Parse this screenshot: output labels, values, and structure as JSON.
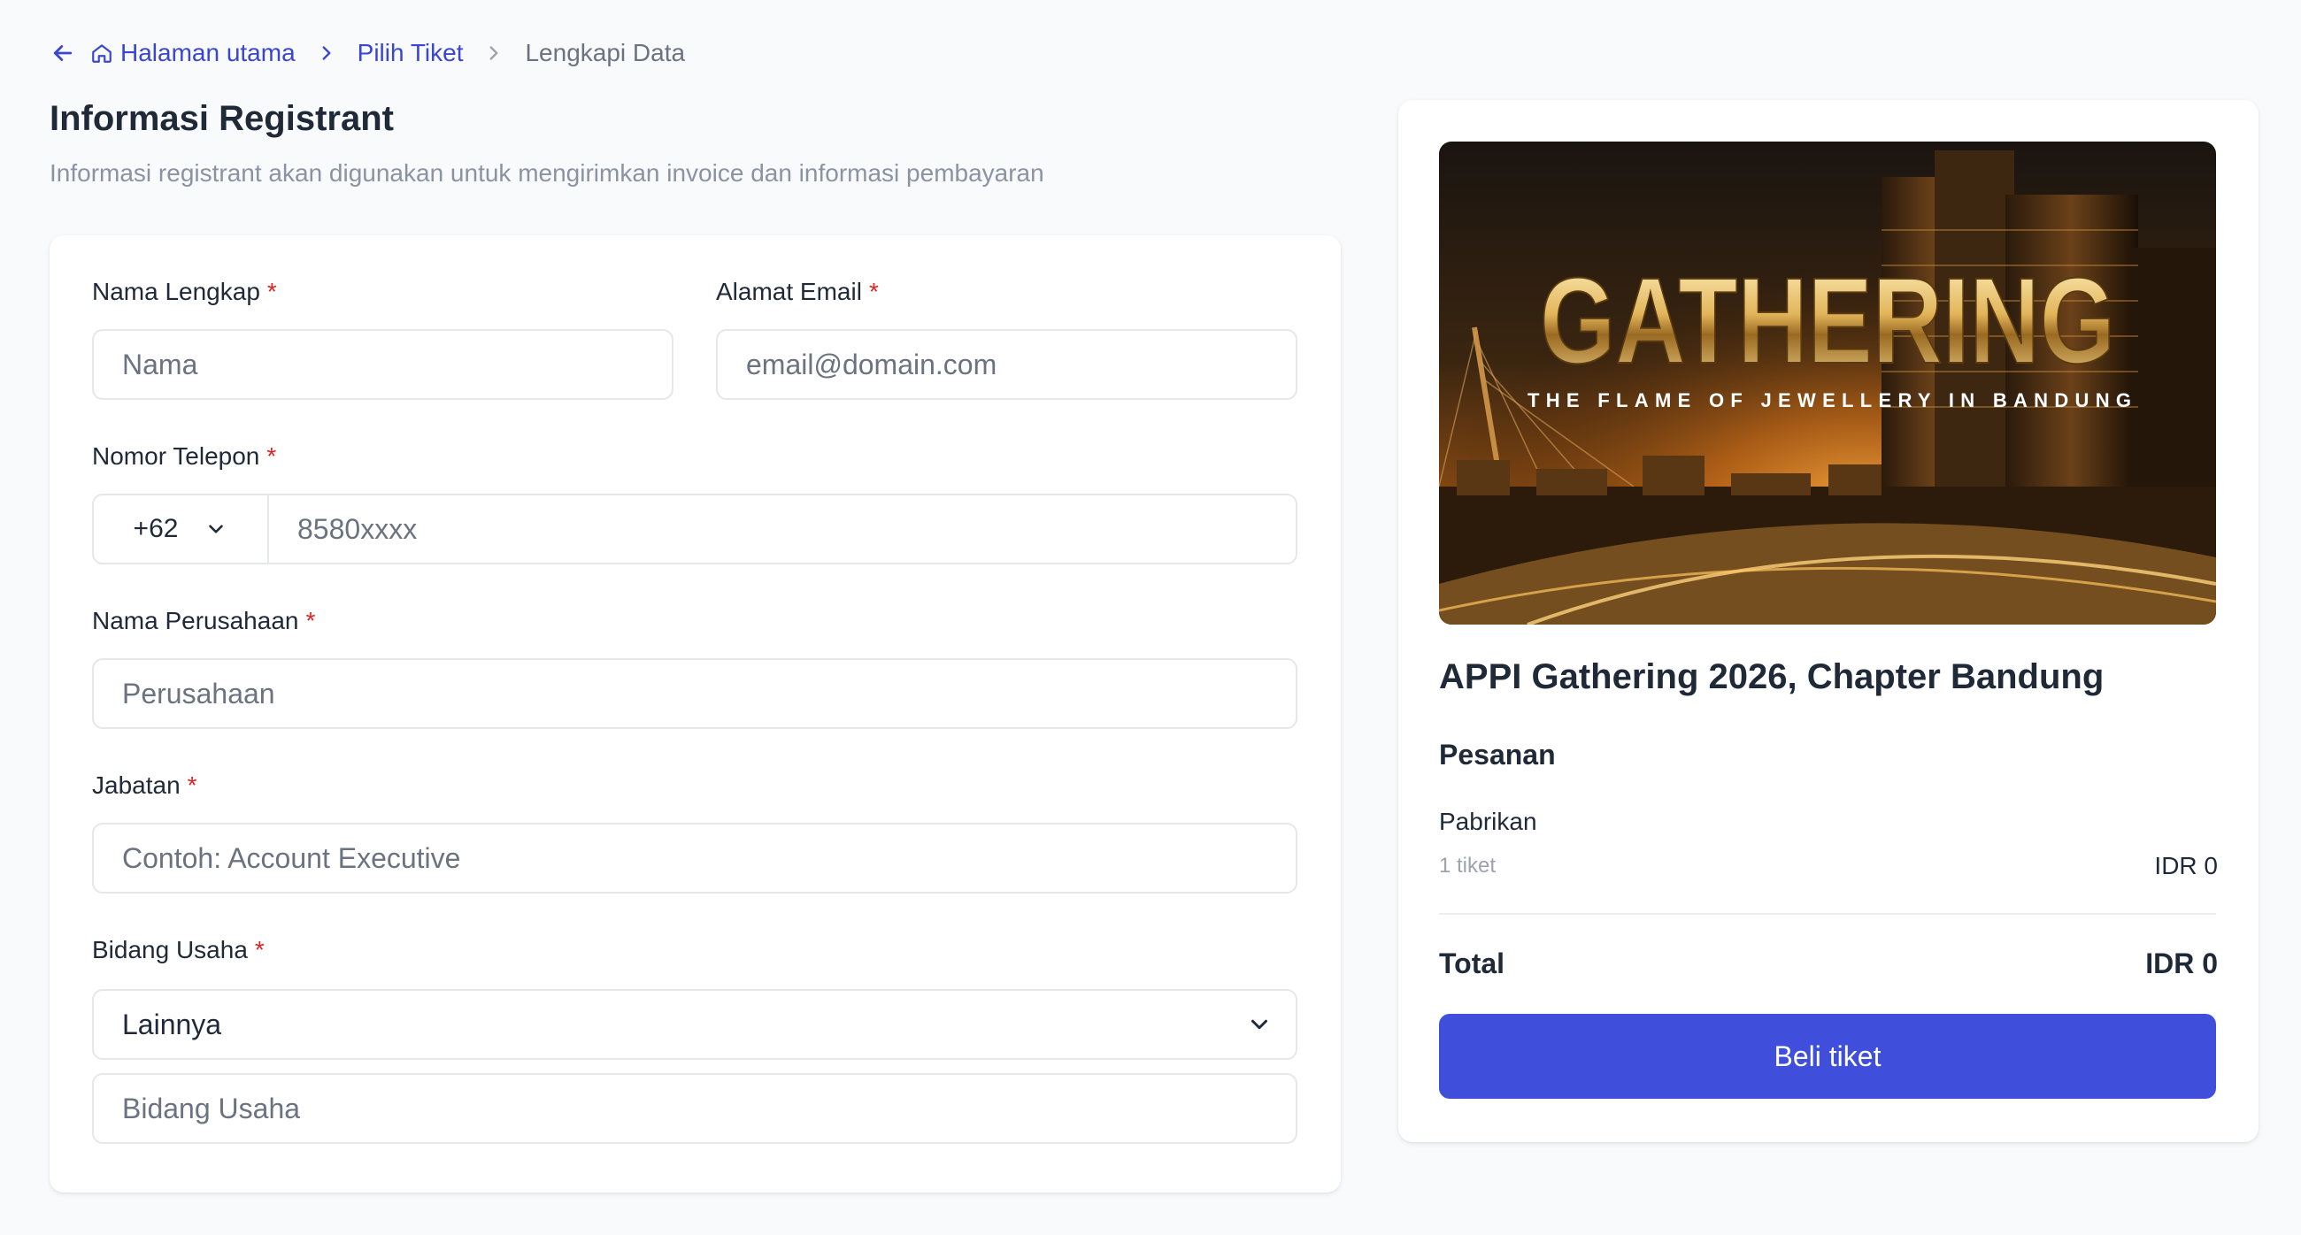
{
  "breadcrumb": {
    "home": "Halaman utama",
    "tickets": "Pilih Tiket",
    "current": "Lengkapi Data"
  },
  "header": {
    "title": "Informasi Registrant",
    "subtitle": "Informasi registrant akan digunakan untuk mengirimkan invoice dan informasi pembayaran"
  },
  "form": {
    "required_mark": "*",
    "full_name": {
      "label": "Nama Lengkap",
      "placeholder": "Nama"
    },
    "email": {
      "label": "Alamat Email",
      "placeholder": "email@domain.com"
    },
    "phone": {
      "label": "Nomor Telepon",
      "country_code": "+62",
      "placeholder": "8580xxxx"
    },
    "company": {
      "label": "Nama Perusahaan",
      "placeholder": "Perusahaan"
    },
    "position": {
      "label": "Jabatan",
      "placeholder": "Contoh: Account Executive"
    },
    "business_field": {
      "label": "Bidang Usaha",
      "selected": "Lainnya",
      "other_placeholder": "Bidang Usaha"
    }
  },
  "summary": {
    "banner": {
      "headline": "GATHERING",
      "tagline": "THE FLAME OF JEWELLERY IN BANDUNG"
    },
    "event_title": "APPI Gathering 2026, Chapter Bandung",
    "order_heading": "Pesanan",
    "ticket": {
      "name": "Pabrikan",
      "quantity": "1 tiket",
      "price": "IDR 0"
    },
    "total_label": "Total",
    "total_value": "IDR 0",
    "buy_label": "Beli tiket"
  },
  "colors": {
    "accent": "#3f4fdb",
    "link": "#3b46d0",
    "required": "#e02424"
  }
}
